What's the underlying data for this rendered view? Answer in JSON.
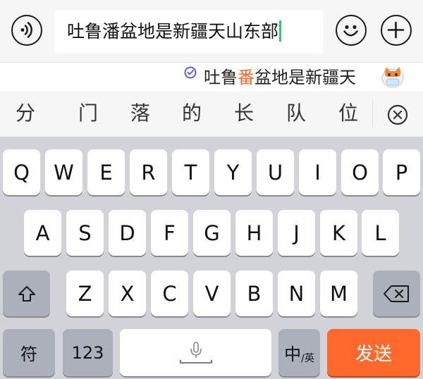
{
  "input": {
    "text": "吐鲁潘盆地是新疆天山东部"
  },
  "suggestion": {
    "pre": "吐鲁",
    "highlight": "番",
    "post": "盆地是新疆天"
  },
  "candidates": [
    "分",
    "门",
    "落",
    "的",
    "长",
    "队",
    "位"
  ],
  "keys": {
    "row1": [
      "Q",
      "W",
      "E",
      "R",
      "T",
      "Y",
      "U",
      "I",
      "O",
      "P"
    ],
    "row2": [
      "A",
      "S",
      "D",
      "F",
      "G",
      "H",
      "J",
      "K",
      "L"
    ],
    "row3": [
      "Z",
      "X",
      "C",
      "V",
      "B",
      "N",
      "M"
    ],
    "symbol": "符",
    "numbers": "123",
    "lang_main": "中",
    "lang_sub": "/英",
    "send": "发送"
  },
  "colors": {
    "accent": "#ff6a2c",
    "caret": "#2ecc71"
  },
  "icons": [
    "voice-icon",
    "emoji-icon",
    "plus-icon",
    "shield-check-icon",
    "mascot-icon",
    "close-icon",
    "shift-icon",
    "backspace-icon",
    "microphone-icon"
  ]
}
